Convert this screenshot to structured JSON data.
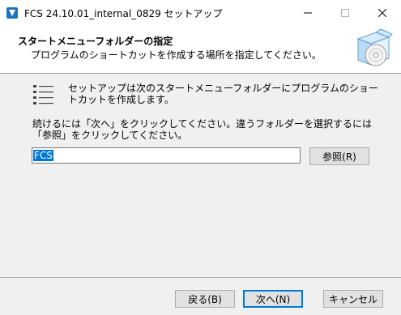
{
  "window": {
    "title": "FCS 24.10.01_internal_0829 セットアップ",
    "app_icon": "installer-icon",
    "controls": [
      "minimize",
      "maximize",
      "close"
    ]
  },
  "header": {
    "title": "スタートメニューフォルダーの指定",
    "subtitle": "プログラムのショートカットを作成する場所を指定してください。",
    "graphic": "box-disc-icon"
  },
  "body": {
    "description": "セットアップは次のスタートメニューフォルダーにプログラムのショートカットを作成します。",
    "instruction": "続けるには「次へ」をクリックしてください。違うフォルダーを選択するには「参照」をクリックしてください。",
    "folder_value": "FCS",
    "browse_label": "参照(R)"
  },
  "footer": {
    "back_label": "戻る(B)",
    "next_label": "次へ(N)",
    "cancel_label": "キャンセル"
  }
}
